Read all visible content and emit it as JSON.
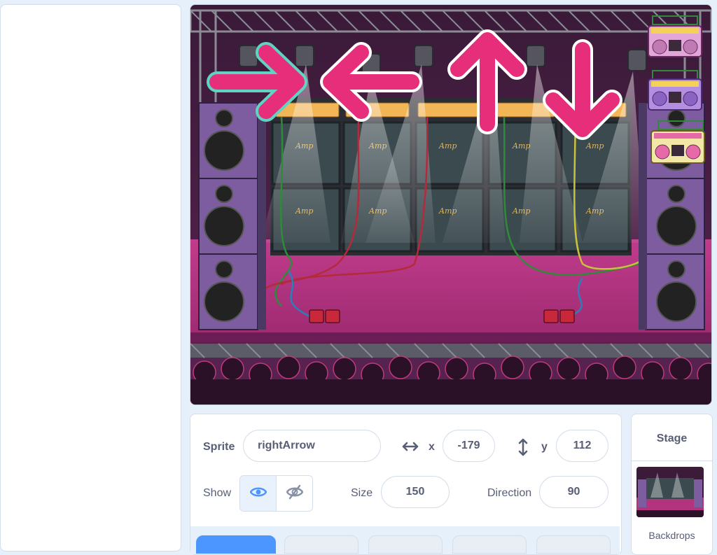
{
  "sprite_info": {
    "sprite_label": "Sprite",
    "sprite_name": "rightArrow",
    "x_label": "x",
    "x_value": "-179",
    "y_label": "y",
    "y_value": "112",
    "show_label": "Show",
    "size_label": "Size",
    "size_value": "150",
    "direction_label": "Direction",
    "direction_value": "90"
  },
  "stage_panel": {
    "title": "Stage",
    "backdrops_label": "Backdrops"
  },
  "stage_sprites": [
    "rightArrow",
    "leftArrow",
    "upArrow",
    "downArrow",
    "boombox",
    "boombox",
    "boombox"
  ],
  "stage_text": {
    "amp_label": "Amp"
  },
  "colors": {
    "arrow": "#e62e7b",
    "selected_outline": "#5fd4c3",
    "accent_blue": "#4c97ff",
    "stage_floor": "#b4337e",
    "backdrop_bg": "#3c1b39"
  },
  "icons": [
    "eye-icon",
    "eye-hidden-icon",
    "horizontal-arrows-icon",
    "vertical-arrows-icon"
  ]
}
